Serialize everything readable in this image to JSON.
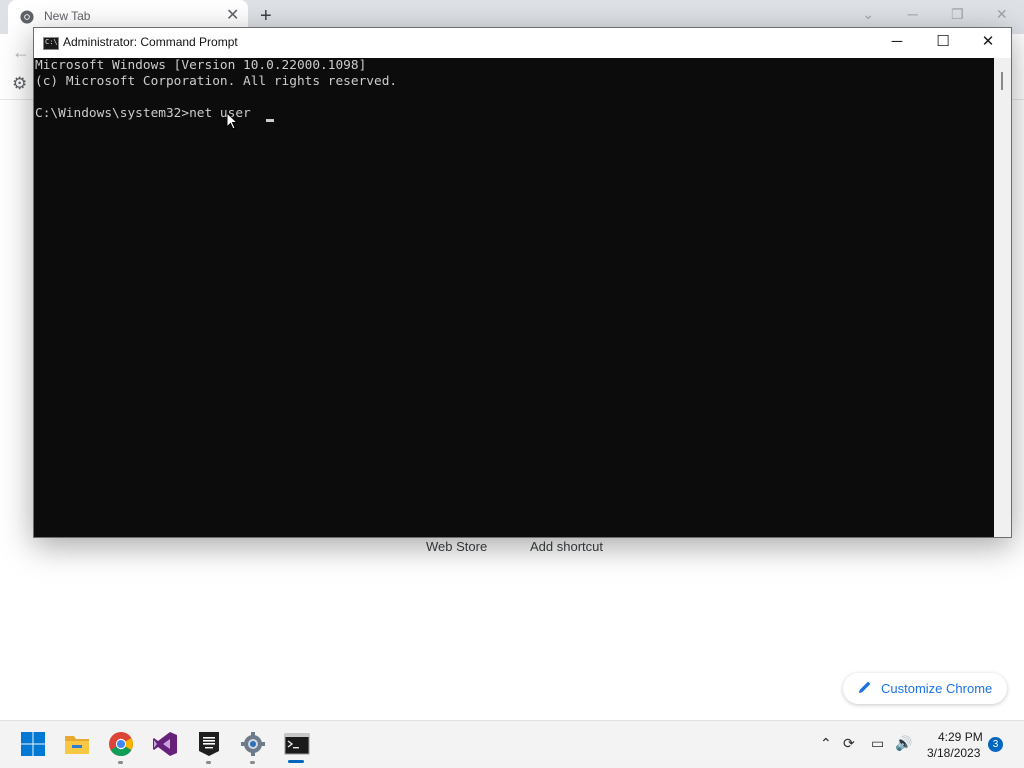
{
  "browser": {
    "tab_title": "New Tab",
    "tab_close_glyph": "✕",
    "new_tab_glyph": "+",
    "back_glyph": "←",
    "gear_glyph": "⚙",
    "caption_glyphs": [
      "⌄",
      "─",
      "❐",
      "✕"
    ],
    "shortcuts": {
      "web_store": "Web Store",
      "add_shortcut": "Add shortcut"
    },
    "customize_label": "Customize Chrome"
  },
  "cmd": {
    "title": "Administrator: Command Prompt",
    "icon_text": "C:\\",
    "minimize_glyph": "─",
    "maximize_glyph": "☐",
    "close_glyph": "✕",
    "lines": [
      "Microsoft Windows [Version 10.0.22000.1098]",
      "(c) Microsoft Corporation. All rights reserved.",
      "C:\\Windows\\system32>net user "
    ]
  },
  "taskbar": {
    "apps": [
      "start-icon",
      "file-explorer-icon",
      "chrome-icon",
      "visual-studio-icon",
      "epic-games-icon",
      "settings-icon",
      "command-prompt-icon"
    ],
    "tray": {
      "chevron_glyph": "⌃",
      "sync_glyph": "⟳",
      "monitor_glyph": "▭",
      "volume_glyph": "🔊"
    },
    "time": "4:29 PM",
    "date": "3/18/2023",
    "notification_count": "3"
  },
  "colors": {
    "cmd_background": "#0c0c0c",
    "cmd_text": "#cccccc",
    "accent": "#0067c0",
    "chrome_link": "#1a73e8"
  }
}
